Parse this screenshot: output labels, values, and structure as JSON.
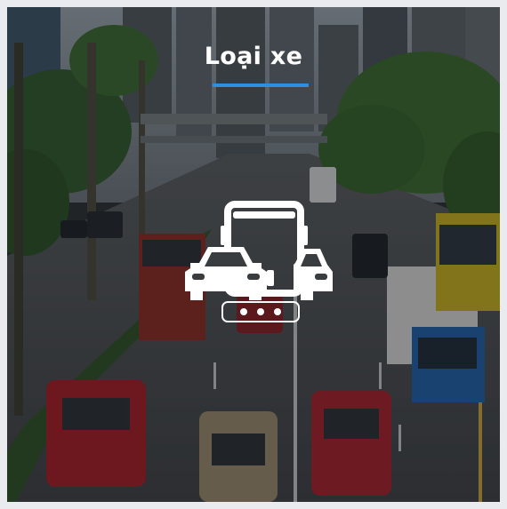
{
  "card": {
    "title": "Loại xe",
    "accent_color": "#2e8fe0",
    "icon": "vehicles-icon",
    "icon_badge": "more-dots-icon"
  }
}
